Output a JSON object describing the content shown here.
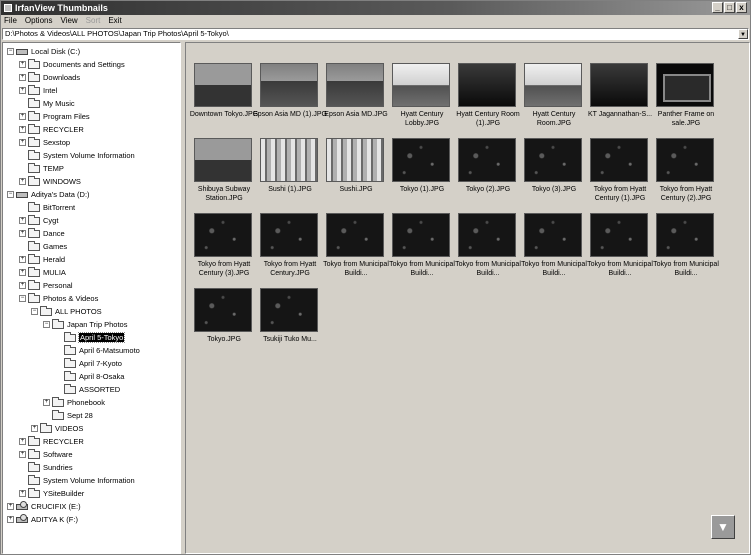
{
  "window": {
    "title": "IrfanView Thumbnails",
    "btn_min": "_",
    "btn_max": "□",
    "btn_close": "x"
  },
  "menu": {
    "items": [
      {
        "label": "File"
      },
      {
        "label": "Options"
      },
      {
        "label": "View"
      },
      {
        "label": "Sort"
      },
      {
        "label": "Exit"
      }
    ]
  },
  "address": {
    "path": "D:\\Photos & Videos\\ALL PHOTOS\\Japan Trip Photos\\April 5-Tokyo\\",
    "dropdown": "▼"
  },
  "tree": {
    "nodes": [
      {
        "label": "Local Disk (C:)",
        "level": 0,
        "expander": "−",
        "icon": "drive-icon"
      },
      {
        "label": "Documents and Settings",
        "level": 1,
        "expander": "+",
        "icon": "folder-icon"
      },
      {
        "label": "Downloads",
        "level": 1,
        "expander": "+",
        "icon": "folder-icon"
      },
      {
        "label": "Intel",
        "level": 1,
        "expander": "+",
        "icon": "folder-icon"
      },
      {
        "label": "My Music",
        "level": 1,
        "expander": "",
        "icon": "folder-icon"
      },
      {
        "label": "Program Files",
        "level": 1,
        "expander": "+",
        "icon": "folder-icon"
      },
      {
        "label": "RECYCLER",
        "level": 1,
        "expander": "+",
        "icon": "folder-icon"
      },
      {
        "label": "Sexstop",
        "level": 1,
        "expander": "+",
        "icon": "folder-icon"
      },
      {
        "label": "System Volume Information",
        "level": 1,
        "expander": "",
        "icon": "folder-icon"
      },
      {
        "label": "TEMP",
        "level": 1,
        "expander": "",
        "icon": "folder-icon"
      },
      {
        "label": "WINDOWS",
        "level": 1,
        "expander": "+",
        "icon": "folder-icon"
      },
      {
        "label": "Aditya's Data (D:)",
        "level": 0,
        "expander": "−",
        "icon": "drive-icon"
      },
      {
        "label": "BitTorrent",
        "level": 1,
        "expander": "",
        "icon": "folder-icon"
      },
      {
        "label": "Cygt",
        "level": 1,
        "expander": "+",
        "icon": "folder-icon"
      },
      {
        "label": "Dance",
        "level": 1,
        "expander": "+",
        "icon": "folder-icon"
      },
      {
        "label": "Games",
        "level": 1,
        "expander": "",
        "icon": "folder-icon"
      },
      {
        "label": "Herald",
        "level": 1,
        "expander": "+",
        "icon": "folder-icon"
      },
      {
        "label": "MULIA",
        "level": 1,
        "expander": "+",
        "icon": "folder-icon"
      },
      {
        "label": "Personal",
        "level": 1,
        "expander": "+",
        "icon": "folder-icon"
      },
      {
        "label": "Photos & Videos",
        "level": 1,
        "expander": "−",
        "icon": "folder-icon"
      },
      {
        "label": "ALL PHOTOS",
        "level": 2,
        "expander": "−",
        "icon": "folder-icon"
      },
      {
        "label": "Japan Trip Photos",
        "level": 3,
        "expander": "−",
        "icon": "folder-icon"
      },
      {
        "label": "April 5-Tokyo",
        "level": 4,
        "expander": "",
        "icon": "folder-icon",
        "selected": true
      },
      {
        "label": "April 6-Matsumoto",
        "level": 4,
        "expander": "",
        "icon": "folder-icon"
      },
      {
        "label": "April 7-Kyoto",
        "level": 4,
        "expander": "",
        "icon": "folder-icon"
      },
      {
        "label": "April 8-Osaka",
        "level": 4,
        "expander": "",
        "icon": "folder-icon"
      },
      {
        "label": "ASSORTED",
        "level": 4,
        "expander": "",
        "icon": "folder-icon"
      },
      {
        "label": "Phonebook",
        "level": 3,
        "expander": "+",
        "icon": "folder-icon"
      },
      {
        "label": "Sept 28",
        "level": 3,
        "expander": "",
        "icon": "folder-icon"
      },
      {
        "label": "VIDEOS",
        "level": 2,
        "expander": "+",
        "icon": "folder-icon"
      },
      {
        "label": "RECYCLER",
        "level": 1,
        "expander": "+",
        "icon": "folder-icon"
      },
      {
        "label": "Software",
        "level": 1,
        "expander": "+",
        "icon": "folder-icon"
      },
      {
        "label": "Sundries",
        "level": 1,
        "expander": "",
        "icon": "folder-icon"
      },
      {
        "label": "System Volume Information",
        "level": 1,
        "expander": "",
        "icon": "folder-icon"
      },
      {
        "label": "YSiteBuilder",
        "level": 1,
        "expander": "+",
        "icon": "folder-icon"
      },
      {
        "label": "CRUCIFIX (E:)",
        "level": 0,
        "expander": "+",
        "icon": "cd-icon"
      },
      {
        "label": "ADITYA K (F:)",
        "level": 0,
        "expander": "+",
        "icon": "cd-icon"
      }
    ]
  },
  "thumbnails": [
    {
      "caption": "Downtown Tokyo.JPG",
      "style": "city"
    },
    {
      "caption": "Epson Asia MD (1).JPG",
      "style": "people"
    },
    {
      "caption": "Epson Asia MD.JPG",
      "style": "people"
    },
    {
      "caption": "Hyatt Century Lobby.JPG",
      "style": "light"
    },
    {
      "caption": "Hyatt Century Room (1).JPG",
      "style": "dark"
    },
    {
      "caption": "Hyatt Century Room.JPG",
      "style": "light"
    },
    {
      "caption": "KT Jagannathan-S...",
      "style": "dark"
    },
    {
      "caption": "Panther Frame on sale.JPG",
      "style": "tv"
    },
    {
      "caption": "Shibuya Subway Station.JPG",
      "style": "city"
    },
    {
      "caption": "Sushi (1).JPG",
      "style": "store"
    },
    {
      "caption": "Sushi.JPG",
      "style": "store"
    },
    {
      "caption": "Tokyo (1).JPG",
      "style": "night"
    },
    {
      "caption": "Tokyo (2).JPG",
      "style": "night"
    },
    {
      "caption": "Tokyo (3).JPG",
      "style": "night"
    },
    {
      "caption": "Tokyo from Hyatt Century (1).JPG",
      "style": "night"
    },
    {
      "caption": "Tokyo from Hyatt Century (2).JPG",
      "style": "night"
    },
    {
      "caption": "Tokyo from Hyatt Century (3).JPG",
      "style": "night"
    },
    {
      "caption": "Tokyo from Hyatt Century.JPG",
      "style": "night"
    },
    {
      "caption": "Tokyo from Municipal Buildi...",
      "style": "night"
    },
    {
      "caption": "Tokyo from Municipal Buildi...",
      "style": "night"
    },
    {
      "caption": "Tokyo from Municipal Buildi...",
      "style": "night"
    },
    {
      "caption": "Tokyo from Municipal Buildi...",
      "style": "night"
    },
    {
      "caption": "Tokyo from Municipal Buildi...",
      "style": "night"
    },
    {
      "caption": "Tokyo from Municipal Buildi...",
      "style": "night"
    },
    {
      "caption": "Tokyo.JPG",
      "style": "night"
    },
    {
      "caption": "Tsukiji Tuko Mu...",
      "style": "night"
    }
  ],
  "corner_button": "▼"
}
